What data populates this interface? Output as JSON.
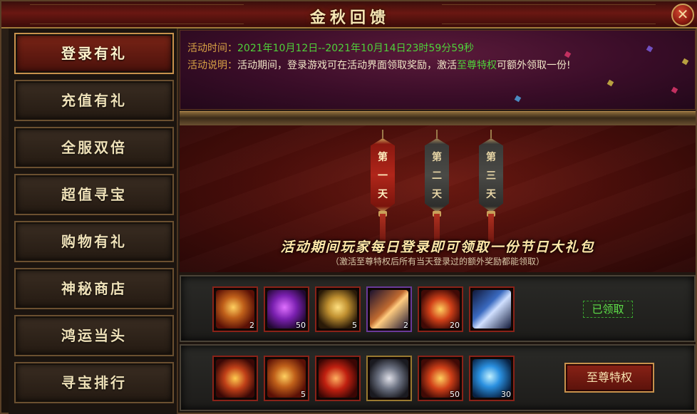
{
  "window": {
    "title": "金秋回馈",
    "close_glyph": "✕"
  },
  "sidebar": {
    "items": [
      {
        "label": "登录有礼",
        "active": true
      },
      {
        "label": "充值有礼",
        "active": false
      },
      {
        "label": "全服双倍",
        "active": false
      },
      {
        "label": "超值寻宝",
        "active": false
      },
      {
        "label": "购物有礼",
        "active": false
      },
      {
        "label": "神秘商店",
        "active": false
      },
      {
        "label": "鸿运当头",
        "active": false
      },
      {
        "label": "寻宝排行",
        "active": false
      }
    ]
  },
  "info": {
    "time_label": "活动时间：",
    "time_value": "2021年10月12日--2021年10月14日23时59分59秒",
    "desc_label": "活动说明：",
    "desc_text_1": "活动期间，登录游戏可在活动界面领取奖励，激活",
    "desc_highlight": "至尊特权",
    "desc_text_2": "可额外领取一份!"
  },
  "days": [
    {
      "label": "第一天",
      "chars": [
        "第",
        "一",
        "天"
      ],
      "selected": true
    },
    {
      "label": "第二天",
      "chars": [
        "第",
        "二",
        "天"
      ],
      "selected": false
    },
    {
      "label": "第三天",
      "chars": [
        "第",
        "三",
        "天"
      ],
      "selected": false
    }
  ],
  "banner": {
    "title": "活动期间玩家每日登录即可领取一份节日大礼包",
    "subtitle": "（激活至尊特权后所有当天登录过的额外奖励都能领取）"
  },
  "rewards_basic": {
    "status": "已领取",
    "items": [
      {
        "icon": "golden-key-icon",
        "count": "2"
      },
      {
        "icon": "purple-orb-icon",
        "count": "50"
      },
      {
        "icon": "horn-icon",
        "count": "5"
      },
      {
        "icon": "scroll-roll-icon",
        "count": "2"
      },
      {
        "icon": "gold-badge-icon",
        "count": "20"
      },
      {
        "icon": "blue-scroll-icon",
        "count": ""
      }
    ]
  },
  "rewards_vip": {
    "button": "至尊特权",
    "items": [
      {
        "icon": "red-treasure-chest-icon",
        "count": ""
      },
      {
        "icon": "golden-key-icon",
        "count": "5"
      },
      {
        "icon": "red-scepter-icon",
        "count": ""
      },
      {
        "icon": "silver-chest-icon",
        "count": ""
      },
      {
        "icon": "gold-badge-icon",
        "count": "50"
      },
      {
        "icon": "blue-orb-icon",
        "count": "30"
      }
    ]
  },
  "colors": {
    "accent_green": "#4fd13a",
    "label_gold": "#d9a345",
    "active_red": "#7a2416"
  }
}
